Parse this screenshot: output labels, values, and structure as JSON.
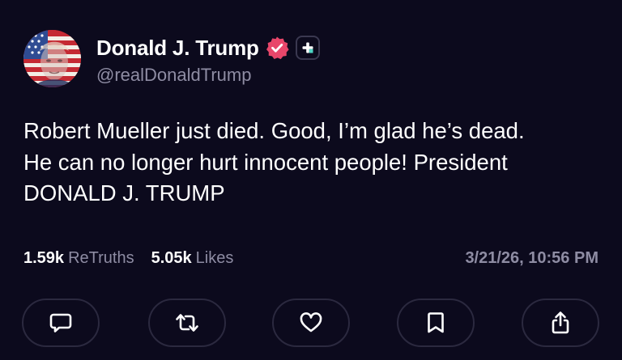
{
  "author": {
    "display_name": "Donald J. Trump",
    "handle": "@realDonaldTrump",
    "verified_badge_color": "#e8466a",
    "avatar_icon": "flag-portrait-avatar"
  },
  "post": {
    "lines": [
      "Robert Mueller just died. Good, I’m glad he’s dead.",
      "He can no longer hurt innocent people! President",
      "DONALD J. TRUMP"
    ]
  },
  "stats": {
    "retruths_count": "1.59k",
    "retruths_label": "ReTruths",
    "likes_count": "5.05k",
    "likes_label": "Likes",
    "timestamp": "3/21/26, 10:56 PM"
  },
  "actions": [
    {
      "name": "reply",
      "icon": "comment-icon"
    },
    {
      "name": "retruth",
      "icon": "repost-icon"
    },
    {
      "name": "like",
      "icon": "heart-icon"
    },
    {
      "name": "bookmark",
      "icon": "bookmark-icon"
    },
    {
      "name": "share",
      "icon": "share-icon"
    }
  ],
  "colors": {
    "background": "#0c0a1d",
    "text": "#ffffff",
    "muted": "#8e8ca3",
    "button_border": "#2b293f"
  }
}
